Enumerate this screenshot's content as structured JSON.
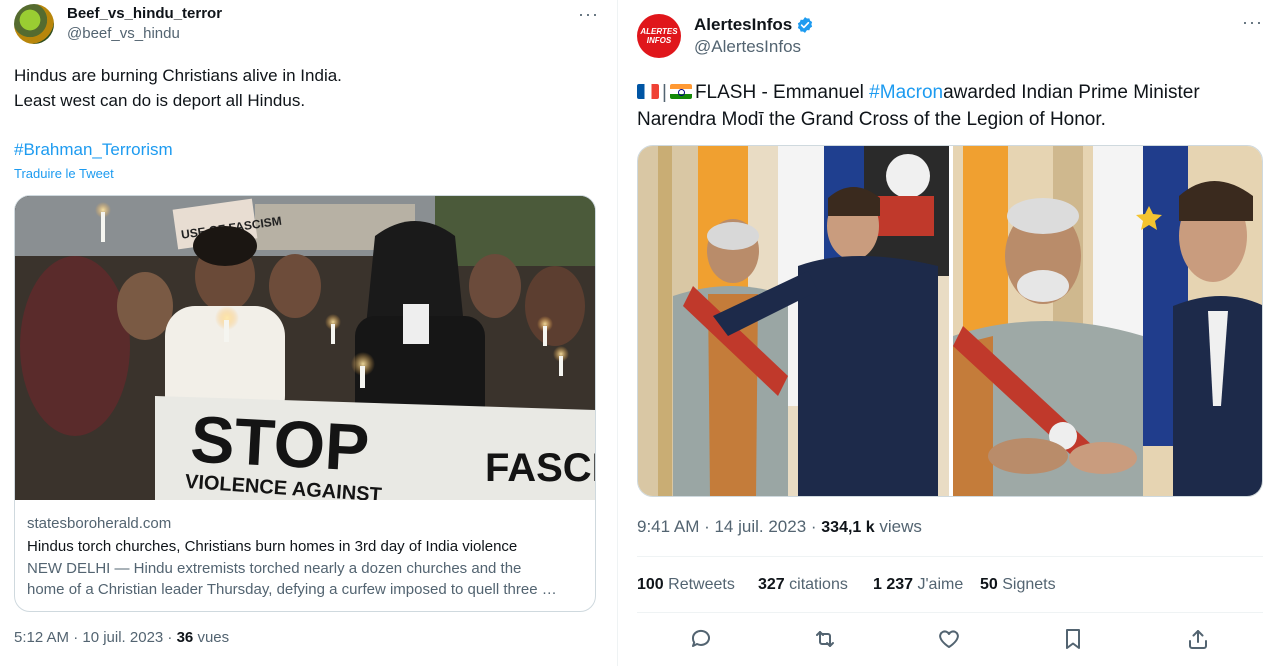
{
  "left_tweet": {
    "author_name": "Beef_vs_hindu_terror",
    "handle": "@beef_vs_hindu",
    "text_line1": "Hindus are burning Christians alive in India.",
    "text_line2": "Least west can do is deport all Hindus.",
    "hashtag": "#Brahman_Terrorism",
    "translate_label": "Traduire le Tweet",
    "card": {
      "image_sign_top": "USE OF FASCISM",
      "banner_word": "STOP",
      "banner_sub": "VIOLENCE AGAINST",
      "banner_right": "FASCIS",
      "domain": "statesboroherald.com",
      "title": "Hindus torch churches, Christians burn homes in 3rd day of India violence",
      "desc_line1": "NEW DELHI — Hindu extremists torched nearly a dozen churches and the",
      "desc_line2": "home of a Christian leader Thursday, defying a curfew imposed to quell three …"
    },
    "time_date": "5:12 AM · 10 juil. 2023 · ",
    "views_count": "36",
    "views_label": "vues"
  },
  "right_tweet": {
    "avatar_text_1": "ALERTES",
    "avatar_text_2": "INFOS",
    "author_name": "AlertesInfos",
    "handle": "@AlertesInfos",
    "text_part1": "FLASH - Emmanuel ",
    "hashtag": "#Macron",
    "text_part2": "awarded Indian Prime Minister",
    "text_line2": "Narendra Modī the Grand Cross of the Legion of Honor.",
    "time_date": "9:41 AM · 14 juil. 2023 · ",
    "views_count": "334,1 k",
    "views_label": "views",
    "stats": {
      "retweets_count": "100",
      "retweets_label": "Retweets",
      "quotes_count": "327",
      "quotes_label": "citations",
      "likes_count": "1 237",
      "likes_label": "J'aime",
      "bookmarks_count": "50",
      "bookmarks_label": "Signets"
    },
    "icons": {
      "reply": "reply-icon",
      "retweet": "retweet-icon",
      "like": "heart-icon",
      "bookmark": "bookmark-icon",
      "share": "share-icon"
    }
  },
  "colors": {
    "accent": "#1d9bf0",
    "secondary_text": "#536471",
    "primary_text": "#0f1419",
    "border": "#cfd9de",
    "brand_red": "#e0161b"
  }
}
